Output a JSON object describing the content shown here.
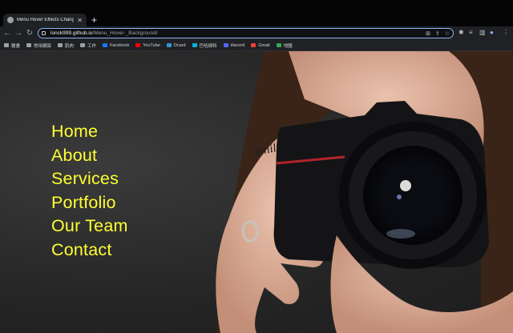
{
  "browser": {
    "tab_title": "Menu Hover Effects Change B",
    "url_host": "lonck999.github.io",
    "url_path": "/Menu_Hover-_Background/",
    "bookmarks": [
      {
        "label": "醫畫",
        "color": "#9aa0a6"
      },
      {
        "label": "常用網頁",
        "color": "#9aa0a6"
      },
      {
        "label": "肌肉",
        "color": "#9aa0a6"
      },
      {
        "label": "工作",
        "color": "#9aa0a6"
      },
      {
        "label": "Facebook",
        "color": "#1877f2"
      },
      {
        "label": "YouTube",
        "color": "#ff0000"
      },
      {
        "label": "Dcard",
        "color": "#3397cf"
      },
      {
        "label": "巴哈姆特",
        "color": "#00b4d8"
      },
      {
        "label": "discord",
        "color": "#5865f2"
      },
      {
        "label": "Gmail",
        "color": "#ea4335"
      },
      {
        "label": "地圖",
        "color": "#34a853"
      }
    ]
  },
  "menu": {
    "items": [
      "Home",
      "About",
      "Services",
      "Portfolio",
      "Our Team",
      "Contact"
    ],
    "color": "#ffff33"
  },
  "hero": {
    "finger_text": "smile"
  }
}
